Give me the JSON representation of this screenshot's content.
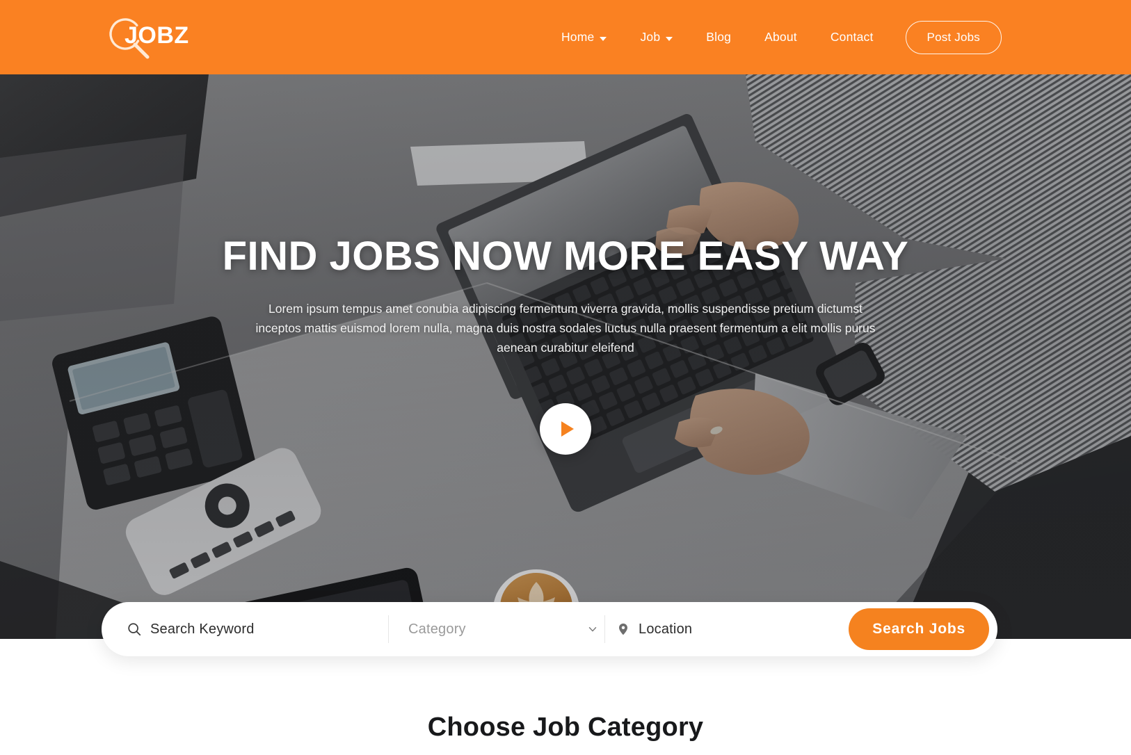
{
  "brand": {
    "logo_text": "JOBZ",
    "logo_icon": "magnifier-icon",
    "accent_color": "#f5821f",
    "header_color": "#fa8122"
  },
  "header": {
    "nav": [
      {
        "label": "Home",
        "has_dropdown": true
      },
      {
        "label": "Job",
        "has_dropdown": true
      },
      {
        "label": "Blog",
        "has_dropdown": false
      },
      {
        "label": "About",
        "has_dropdown": false
      },
      {
        "label": "Contact",
        "has_dropdown": false
      }
    ],
    "cta_label": "Post Jobs"
  },
  "hero": {
    "title": "Find Jobs Now More Easy Way",
    "subtitle": "Lorem ipsum tempus amet conubia adipiscing fermentum viverra gravida, mollis suspendisse pretium dictumst inceptos mattis euismod lorem nulla, magna duis nostra sodales luctus nulla praesent fermentum a elit mollis purus aenean curabitur eleifend",
    "play_button_label": "Play video"
  },
  "search": {
    "keyword": {
      "icon": "search-icon",
      "value": "",
      "placeholder": "Search Keyword"
    },
    "category": {
      "icon": "chevron-down-icon",
      "value": "",
      "placeholder": "Category",
      "options": [
        "Category"
      ]
    },
    "location": {
      "icon": "map-pin-icon",
      "value": "",
      "placeholder": "Location"
    },
    "submit_label": "Search Jobs"
  },
  "categories_section": {
    "heading": "Choose Job Category"
  }
}
